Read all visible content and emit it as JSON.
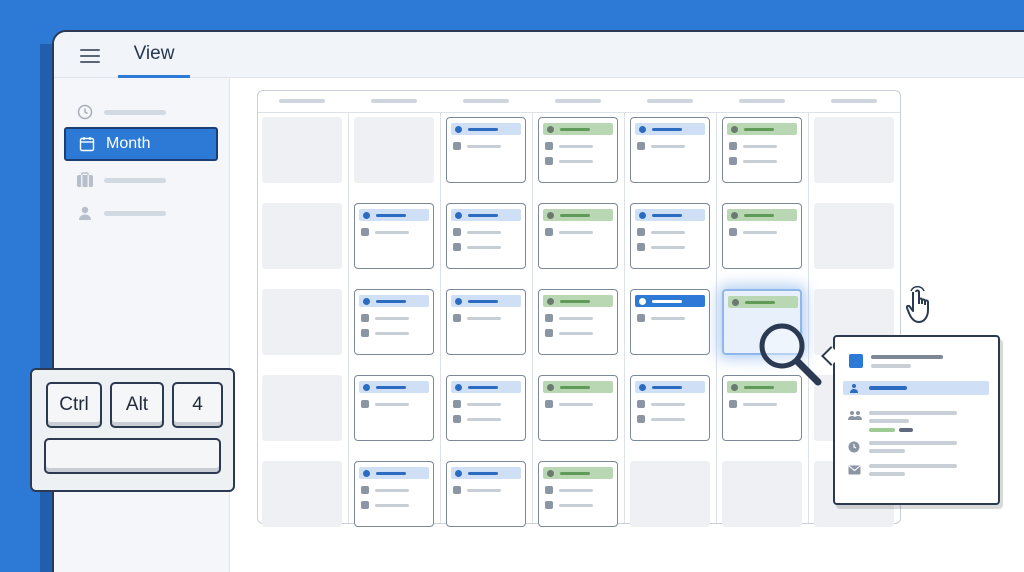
{
  "topbar": {
    "view_tab": "View"
  },
  "sidebar": {
    "items": [
      {
        "icon": "clock-icon"
      },
      {
        "icon": "calendar-icon",
        "label": "Month",
        "selected": true
      },
      {
        "icon": "briefcase-icon"
      },
      {
        "icon": "person-icon"
      }
    ]
  },
  "keyboard": {
    "keys": [
      "Ctrl",
      "Alt",
      "4"
    ]
  },
  "colors": {
    "accent": "#2c7ad6",
    "event_blue": "#cfe0f6",
    "event_green": "#b9d7b2",
    "background": "#2c7ad6",
    "outline": "#2b3a52"
  },
  "calendar": {
    "columns": 7,
    "rows": 5,
    "cells": [
      [
        "empty",
        "empty",
        "blue",
        "green",
        "blue",
        "green",
        "empty"
      ],
      [
        "empty",
        "blue",
        "blue",
        "green",
        "blue",
        "green",
        "empty"
      ],
      [
        "empty",
        "blue",
        "blue",
        "green",
        "solid",
        "green-focus",
        "empty"
      ],
      [
        "empty",
        "blue",
        "blue",
        "green",
        "blue",
        "green",
        "empty"
      ],
      [
        "empty",
        "blue",
        "blue",
        "green",
        "empty",
        "empty",
        "empty"
      ]
    ]
  },
  "popover": {
    "icons": [
      "person-icon",
      "group-icon",
      "clock-icon",
      "mail-icon"
    ]
  }
}
